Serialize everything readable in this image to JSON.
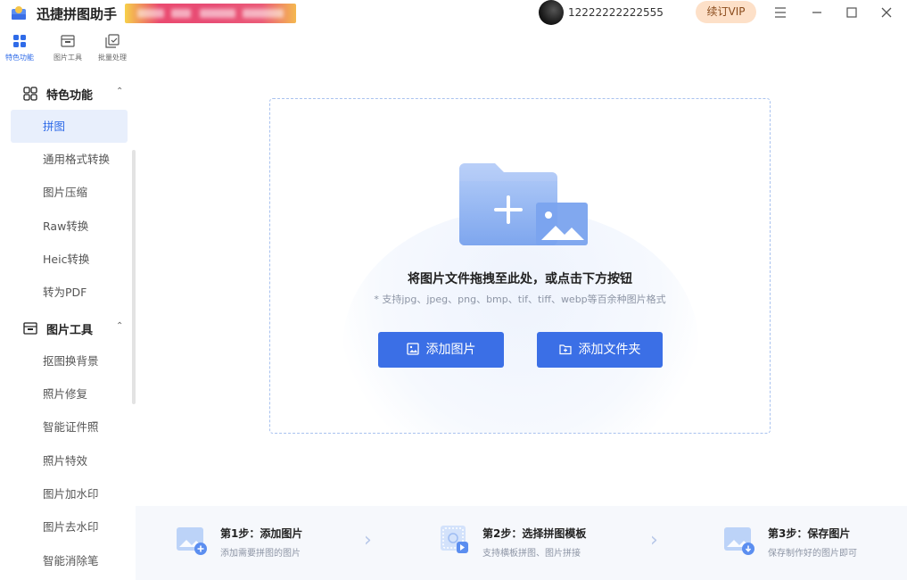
{
  "app": {
    "title": "迅捷拼图助手",
    "user_id": "12222222222555",
    "vip_label": "续订VIP",
    "window_controls": [
      "menu-icon",
      "minimize-icon",
      "maximize-icon",
      "close-icon"
    ]
  },
  "top_tabs": [
    {
      "label": "特色功能",
      "icon": "grid-icon",
      "active": true
    },
    {
      "label": "图片工具",
      "icon": "image-tool-icon",
      "active": false
    },
    {
      "label": "批量处理",
      "icon": "batch-icon",
      "active": false
    }
  ],
  "sidebar": {
    "sections": [
      {
        "title": "特色功能",
        "icon": "grid-icon",
        "items": [
          {
            "label": "拼图",
            "active": true
          },
          {
            "label": "通用格式转换",
            "active": false
          },
          {
            "label": "图片压缩",
            "active": false
          },
          {
            "label": "Raw转换",
            "active": false
          },
          {
            "label": "Heic转换",
            "active": false
          },
          {
            "label": "转为PDF",
            "active": false
          }
        ]
      },
      {
        "title": "图片工具",
        "icon": "image-tool-icon",
        "items": [
          {
            "label": "抠图换背景",
            "active": false
          },
          {
            "label": "照片修复",
            "active": false
          },
          {
            "label": "智能证件照",
            "active": false
          },
          {
            "label": "照片特效",
            "active": false
          },
          {
            "label": "图片加水印",
            "active": false
          },
          {
            "label": "图片去水印",
            "active": false
          },
          {
            "label": "智能消除笔",
            "active": false
          }
        ]
      }
    ]
  },
  "dropzone": {
    "title": "将图片文件拖拽至此处，或点击下方按钮",
    "subtitle": "* 支持jpg、jpeg、png、bmp、tif、tiff、webp等百余种图片格式",
    "add_image_label": "添加图片",
    "add_folder_label": "添加文件夹"
  },
  "steps": [
    {
      "title": "第1步：添加图片",
      "desc": "添加需要拼图的图片",
      "icon": "add-image-icon"
    },
    {
      "title": "第2步：选择拼图模板",
      "desc": "支持横板拼图、图片拼接",
      "icon": "template-icon"
    },
    {
      "title": "第3步：保存图片",
      "desc": "保存制作好的图片即可",
      "icon": "save-image-icon"
    }
  ],
  "colors": {
    "accent": "#3b6fe6",
    "active_bg": "#e8effc",
    "vip_bg": "#fde0c8"
  }
}
